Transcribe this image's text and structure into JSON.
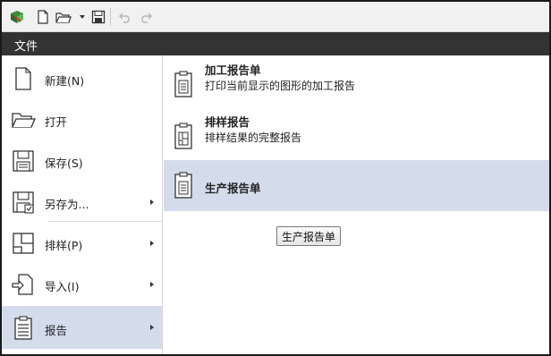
{
  "toolbar": {
    "icons": [
      "app-logo-icon",
      "new-document-icon",
      "open-folder-icon",
      "dropdown-caret-icon",
      "save-icon",
      "undo-icon",
      "redo-icon"
    ]
  },
  "menubar": {
    "title": "文件"
  },
  "left_menu": {
    "items": [
      {
        "label": "新建(N)",
        "icon": "new-document-icon",
        "has_submenu": false
      },
      {
        "label": "打开",
        "icon": "open-folder-icon",
        "has_submenu": false
      },
      {
        "label": "保存(S)",
        "icon": "save-icon",
        "has_submenu": false
      },
      {
        "label": "另存为...",
        "icon": "save-as-icon",
        "has_submenu": true
      },
      {
        "label": "排样(P)",
        "icon": "layout-icon",
        "has_submenu": true
      },
      {
        "label": "导入(I)",
        "icon": "import-icon",
        "has_submenu": true
      },
      {
        "label": "报告",
        "icon": "report-icon",
        "has_submenu": true,
        "selected": true
      }
    ]
  },
  "report_submenu": {
    "items": [
      {
        "title": "加工报告单",
        "description": "打印当前显示的图形的加工报告",
        "icon": "clipboard-report-icon"
      },
      {
        "title": "排样报告",
        "description": "排样结果的完整报告",
        "icon": "clipboard-layout-icon"
      },
      {
        "title": "生产报告单",
        "description": "",
        "icon": "clipboard-report-icon",
        "selected": true
      }
    ]
  },
  "tooltip_button": {
    "label": "生产报告单"
  },
  "colors": {
    "menubar_bg": "#333333",
    "selected_bg": "#d4dcec",
    "toolbar_bg": "#f1f1f1"
  }
}
